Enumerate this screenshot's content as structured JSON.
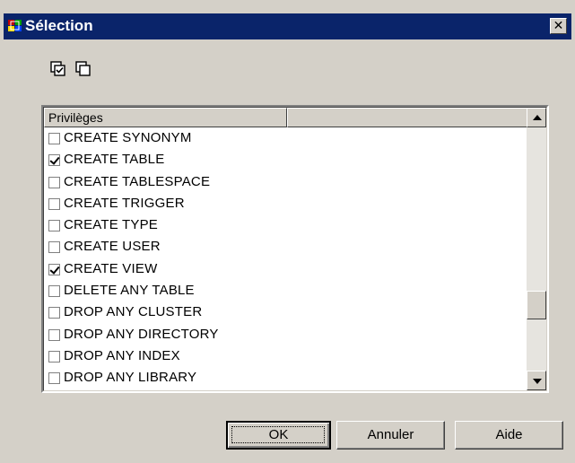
{
  "window": {
    "title": "Sélection",
    "close_label": "✕"
  },
  "toolbar": {
    "icons": [
      "select-all-icon",
      "deselect-all-icon"
    ]
  },
  "list": {
    "columns": [
      "Privilèges",
      ""
    ],
    "rows": [
      {
        "label": "CREATE SYNONYM",
        "checked": false
      },
      {
        "label": "CREATE TABLE",
        "checked": true
      },
      {
        "label": "CREATE TABLESPACE",
        "checked": false
      },
      {
        "label": "CREATE TRIGGER",
        "checked": false
      },
      {
        "label": "CREATE TYPE",
        "checked": false
      },
      {
        "label": "CREATE USER",
        "checked": false
      },
      {
        "label": "CREATE VIEW",
        "checked": true
      },
      {
        "label": "DELETE ANY TABLE",
        "checked": false
      },
      {
        "label": "DROP ANY CLUSTER",
        "checked": false
      },
      {
        "label": "DROP ANY DIRECTORY",
        "checked": false
      },
      {
        "label": "DROP ANY INDEX",
        "checked": false
      },
      {
        "label": "DROP ANY LIBRARY",
        "checked": false
      }
    ],
    "scroll_position": 0.76
  },
  "buttons": {
    "ok": "OK",
    "cancel": "Annuler",
    "help": "Aide"
  }
}
